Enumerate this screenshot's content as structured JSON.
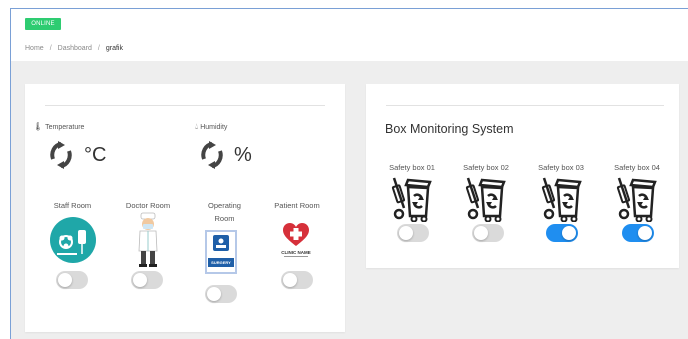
{
  "status_badge": "ONLINE",
  "breadcrumb": {
    "home": "Home",
    "separator": "/",
    "dashboard": "Dashboard",
    "current": "grafik"
  },
  "sensors": {
    "temperature": {
      "label": "Temperature",
      "unit": "°C",
      "icon": "thermometer-icon"
    },
    "humidity": {
      "label": "Humidity",
      "unit": "%",
      "icon": "droplet-icon"
    }
  },
  "rooms": [
    {
      "label": "Staff Room",
      "toggle": "off",
      "icon": "biohazard-medical-icon"
    },
    {
      "label": "Doctor Room",
      "toggle": "off",
      "icon": "doctor-icon"
    },
    {
      "label_line1": "Operating",
      "label_line2": "Room",
      "toggle": "off",
      "icon": "surgery-door-icon",
      "sign_text": "SURGERY"
    },
    {
      "label": "Patient Room",
      "toggle": "off",
      "icon": "clinic-heart-icon",
      "logo_text": "CLINIC NAME"
    }
  ],
  "box_monitoring": {
    "title": "Box Monitoring System",
    "boxes": [
      {
        "label": "Safety box 01",
        "toggle": "off"
      },
      {
        "label": "Safety box 02",
        "toggle": "off"
      },
      {
        "label": "Safety box 03",
        "toggle": "on"
      },
      {
        "label": "Safety box 04",
        "toggle": "on"
      }
    ]
  },
  "colors": {
    "online_green": "#2ecc71",
    "toggle_on_blue": "#1f8ef0",
    "toggle_off_gray": "#dadada",
    "page_background": "#eeeeee"
  }
}
